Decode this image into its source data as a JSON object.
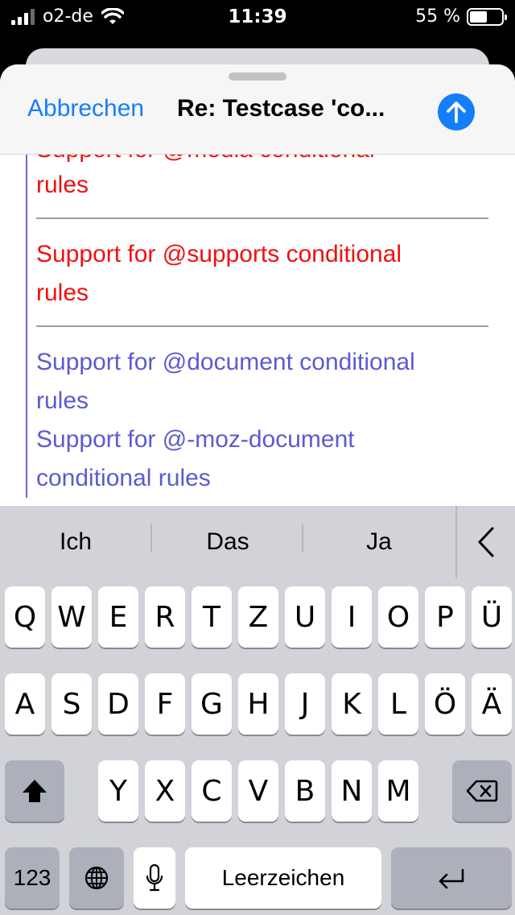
{
  "status_bar": {
    "carrier": "o2-de",
    "time": "11:39",
    "battery": "55 %",
    "battery_fill": 0.55
  },
  "compose": {
    "cancel_label": "Abbrechen",
    "title": "Re: Testcase 'co...",
    "send_icon": "arrow-up-icon"
  },
  "body": {
    "partial_line": "Support for @media conditional",
    "lines": [
      "rules",
      "Support for @supports conditional",
      "rules",
      "Support for @document conditional",
      "rules",
      "Support for @-moz-document",
      "conditional rules"
    ],
    "colors": {
      "red": "#f01010",
      "purple": "#5b5bd0",
      "quote_bar": "#6a66d6"
    }
  },
  "keyboard": {
    "suggestions": [
      "Ich",
      "Das",
      "Ja"
    ],
    "row1": [
      "Q",
      "W",
      "E",
      "R",
      "T",
      "Z",
      "U",
      "I",
      "O",
      "P",
      "Ü"
    ],
    "row2": [
      "A",
      "S",
      "D",
      "F",
      "G",
      "H",
      "J",
      "K",
      "L",
      "Ö",
      "Ä"
    ],
    "row3": [
      "Y",
      "X",
      "C",
      "V",
      "B",
      "N",
      "M"
    ],
    "numbers_label": "123",
    "space_label": "Leerzeichen",
    "icons": [
      "shift-icon",
      "delete-icon",
      "globe-icon",
      "microphone-icon",
      "return-icon",
      "chevron-left-icon"
    ]
  },
  "colors": {
    "accent": "#157efb",
    "keyboard_bg": "#d1d3d9"
  }
}
